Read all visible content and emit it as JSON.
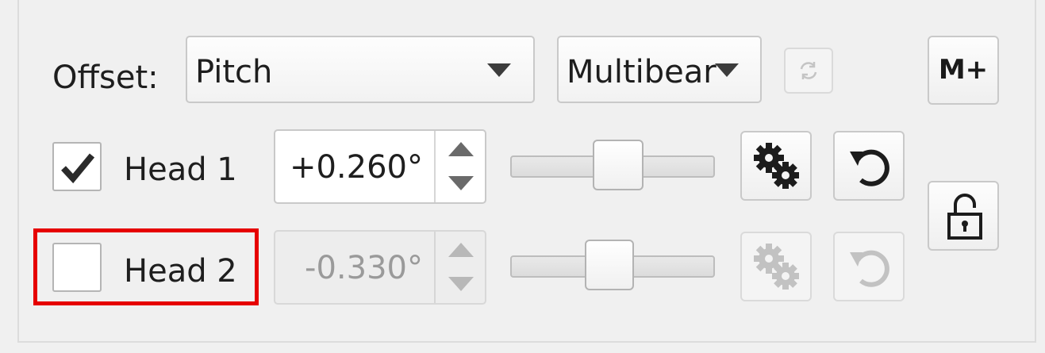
{
  "offset": {
    "label": "Offset:",
    "mode_value": "Pitch",
    "sensor_value": "Multibear"
  },
  "toolbar": {
    "m_plus_label": "M+"
  },
  "heads": [
    {
      "label": "Head 1",
      "checked": true,
      "value": "+0.260°",
      "slider_fraction": 0.52,
      "enabled": true
    },
    {
      "label": "Head 2",
      "checked": false,
      "value": "-0.330°",
      "slider_fraction": 0.48,
      "enabled": false
    }
  ],
  "colors": {
    "highlight": "#e60000",
    "text": "#1e1e1e",
    "disabled_text": "#9a9a9a"
  },
  "icons": {
    "refresh": "refresh-icon",
    "settings": "gears-icon",
    "reset": "undo-icon",
    "lock": "unlocked-padlock-icon",
    "check": "checkmark-icon"
  }
}
